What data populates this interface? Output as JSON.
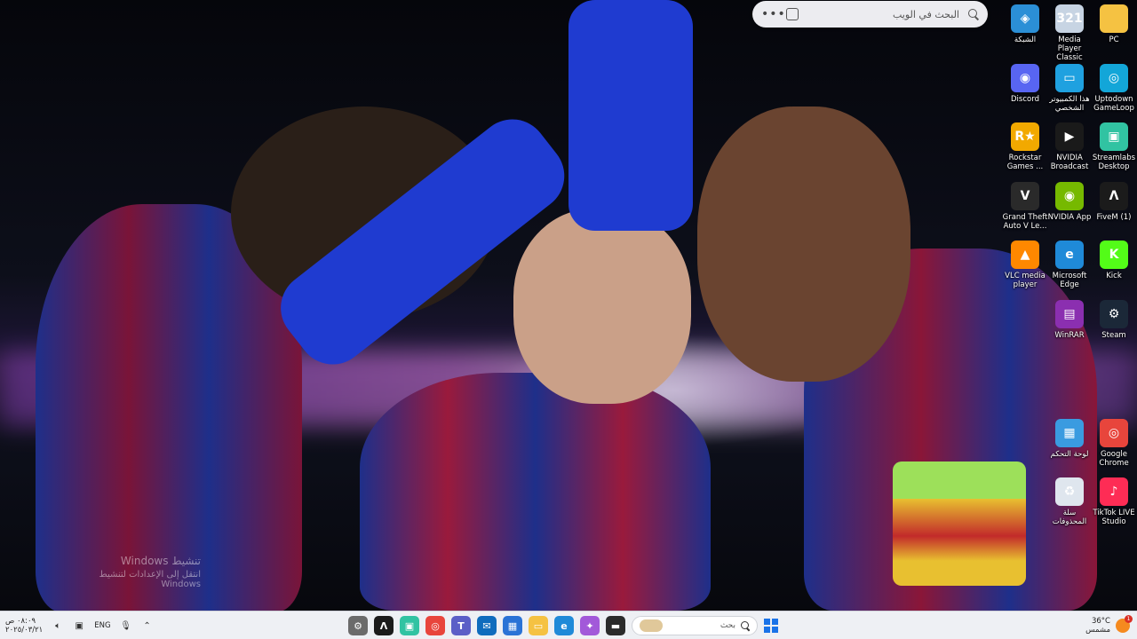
{
  "web_search": {
    "placeholder": "البحث في الويب",
    "more": "•••"
  },
  "desktop_icons": [
    {
      "label": "الشبكة",
      "icon": "network-icon",
      "color": "#2b8fd6",
      "glyph": "◈"
    },
    {
      "label": "Media Player Classic",
      "icon": "media-player-classic-icon",
      "color": "#c7d4e3",
      "glyph": "321"
    },
    {
      "label": "PC",
      "icon": "folder-icon",
      "color": "#f5c242",
      "glyph": ""
    },
    {
      "label": "Discord",
      "icon": "discord-icon",
      "color": "#5865f2",
      "glyph": "◉"
    },
    {
      "label": "هذا الكمبيوتر الشخصي",
      "icon": "this-pc-icon",
      "color": "#1fa1e0",
      "glyph": "▭"
    },
    {
      "label": "Uptodown GameLoop",
      "icon": "gameloop-icon",
      "color": "#13a6d8",
      "glyph": "◎"
    },
    {
      "label": "Rockstar Games ...",
      "icon": "rockstar-icon",
      "color": "#f2a900",
      "glyph": "R★"
    },
    {
      "label": "NVIDIA Broadcast",
      "icon": "nvidia-broadcast-icon",
      "color": "#1a1a1a",
      "glyph": "▶"
    },
    {
      "label": "Streamlabs Desktop",
      "icon": "streamlabs-icon",
      "color": "#31c3a2",
      "glyph": "▣"
    },
    {
      "label": "Grand Theft Auto V Le...",
      "icon": "gta-v-icon",
      "color": "#2a2a2a",
      "glyph": "V"
    },
    {
      "label": "NVIDIA App",
      "icon": "nvidia-app-icon",
      "color": "#76b900",
      "glyph": "◉"
    },
    {
      "label": "FiveM (1)",
      "icon": "fivem-icon",
      "color": "#1b1b1b",
      "glyph": "Λ"
    },
    {
      "label": "VLC media player",
      "icon": "vlc-icon",
      "color": "#ff8800",
      "glyph": "▲"
    },
    {
      "label": "Microsoft Edge",
      "icon": "edge-icon",
      "color": "#1f8ad8",
      "glyph": "e"
    },
    {
      "label": "Kick",
      "icon": "kick-icon",
      "color": "#53fc18",
      "glyph": "K"
    },
    {
      "label": "WinRAR",
      "icon": "winrar-icon",
      "color": "#8b2fb0",
      "glyph": "▤"
    },
    {
      "label": "Steam",
      "icon": "steam-icon",
      "color": "#1b2838",
      "glyph": "⚙"
    },
    {
      "label": "لوحة التحكم",
      "icon": "control-panel-icon",
      "color": "#3a9be0",
      "glyph": "▦"
    },
    {
      "label": "Google Chrome",
      "icon": "chrome-icon",
      "color": "#e8453c",
      "glyph": "◎"
    },
    {
      "label": "سلة المحذوفات",
      "icon": "recycle-bin-icon",
      "color": "#dfe6ee",
      "glyph": "♻"
    },
    {
      "label": "TikTok LIVE Studio",
      "icon": "tiktok-live-icon",
      "color": "#fe2c55",
      "glyph": "♪"
    }
  ],
  "watermark": {
    "title": "Windows تنشيط",
    "subtitle": "انتقل إلى الإعدادات لتنشيط Windows"
  },
  "taskbar": {
    "clock_time": "٠٨:٠٩ ص",
    "clock_date": "٢٠٢٥/٠٣/٢١",
    "language": "ENG",
    "search_placeholder": "بحث",
    "weather_temp": "36°C",
    "weather_desc": "مشمس",
    "notification_count": "1",
    "apps": [
      {
        "name": "taskbar-settings-app",
        "color": "#6b6b6b",
        "glyph": "⚙"
      },
      {
        "name": "taskbar-fivem-app",
        "color": "#1b1b1b",
        "glyph": "Λ"
      },
      {
        "name": "taskbar-streamlabs-app",
        "color": "#31c3a2",
        "glyph": "▣"
      },
      {
        "name": "taskbar-chrome-app",
        "color": "#e8453c",
        "glyph": "◎"
      },
      {
        "name": "taskbar-teams-app",
        "color": "#5b5fc7",
        "glyph": "T"
      },
      {
        "name": "taskbar-mail-app",
        "color": "#0f6cbd",
        "glyph": "✉"
      },
      {
        "name": "taskbar-store-app",
        "color": "#2a73d6",
        "glyph": "▦"
      },
      {
        "name": "taskbar-file-explorer-app",
        "color": "#f5c242",
        "glyph": "▭"
      },
      {
        "name": "taskbar-edge-app",
        "color": "#1f8ad8",
        "glyph": "e"
      },
      {
        "name": "taskbar-copilot-app",
        "color": "#a259d9",
        "glyph": "✦"
      },
      {
        "name": "taskbar-terminal-app",
        "color": "#2b2b2b",
        "glyph": "▬"
      }
    ]
  }
}
